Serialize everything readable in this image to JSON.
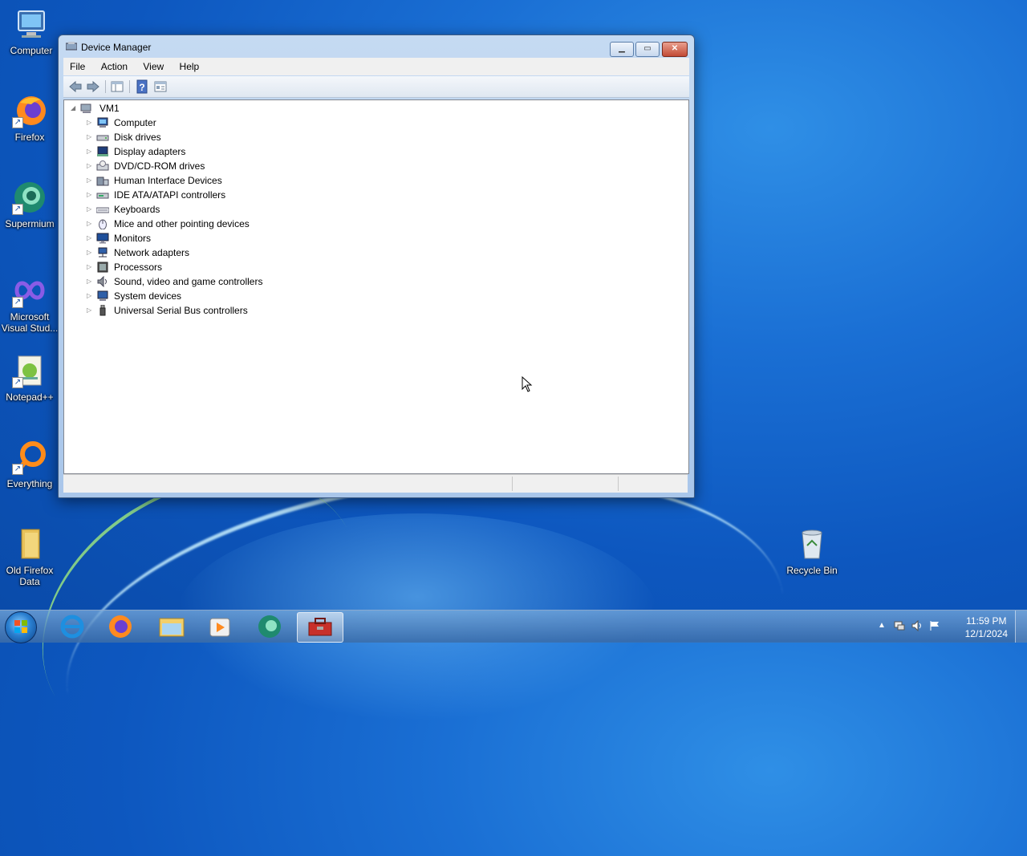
{
  "desktop": {
    "icons": [
      {
        "label": "Computer",
        "icon": "computer-icon"
      },
      {
        "label": "Firefox",
        "icon": "firefox-icon"
      },
      {
        "label": "Supermium",
        "icon": "supermium-icon"
      },
      {
        "label": "Microsoft Visual Stud...",
        "icon": "visual-studio-icon"
      },
      {
        "label": "Notepad++",
        "icon": "notepadpp-icon"
      },
      {
        "label": "Everything",
        "icon": "everything-icon"
      },
      {
        "label": "Old Firefox Data",
        "icon": "folder-icon"
      },
      {
        "label": "Recycle Bin",
        "icon": "recycle-bin-icon"
      }
    ]
  },
  "window": {
    "title": "Device Manager",
    "menu": [
      "File",
      "Action",
      "View",
      "Help"
    ],
    "toolbar": [
      "back-arrow-icon",
      "forward-arrow-icon",
      "show-hide-console-tree-icon",
      "help-icon",
      "properties-icon"
    ],
    "tree": {
      "root": "VM1",
      "categories": [
        {
          "label": "Computer",
          "icon": "computer-icon"
        },
        {
          "label": "Disk drives",
          "icon": "disk-drive-icon"
        },
        {
          "label": "Display adapters",
          "icon": "display-adapter-icon"
        },
        {
          "label": "DVD/CD-ROM drives",
          "icon": "dvd-drive-icon"
        },
        {
          "label": "Human Interface Devices",
          "icon": "hid-icon"
        },
        {
          "label": "IDE ATA/ATAPI controllers",
          "icon": "ide-controller-icon"
        },
        {
          "label": "Keyboards",
          "icon": "keyboard-icon"
        },
        {
          "label": "Mice and other pointing devices",
          "icon": "mouse-icon"
        },
        {
          "label": "Monitors",
          "icon": "monitor-icon"
        },
        {
          "label": "Network adapters",
          "icon": "network-adapter-icon"
        },
        {
          "label": "Processors",
          "icon": "processor-icon"
        },
        {
          "label": "Sound, video and game controllers",
          "icon": "sound-icon"
        },
        {
          "label": "System devices",
          "icon": "system-devices-icon"
        },
        {
          "label": "Universal Serial Bus controllers",
          "icon": "usb-icon"
        }
      ]
    }
  },
  "taskbar": {
    "apps": [
      "internet-explorer-icon",
      "firefox-icon",
      "file-explorer-icon",
      "media-player-icon",
      "supermium-icon",
      "device-manager-icon"
    ],
    "clock_time": "11:59 PM",
    "clock_date": "12/1/2024"
  }
}
